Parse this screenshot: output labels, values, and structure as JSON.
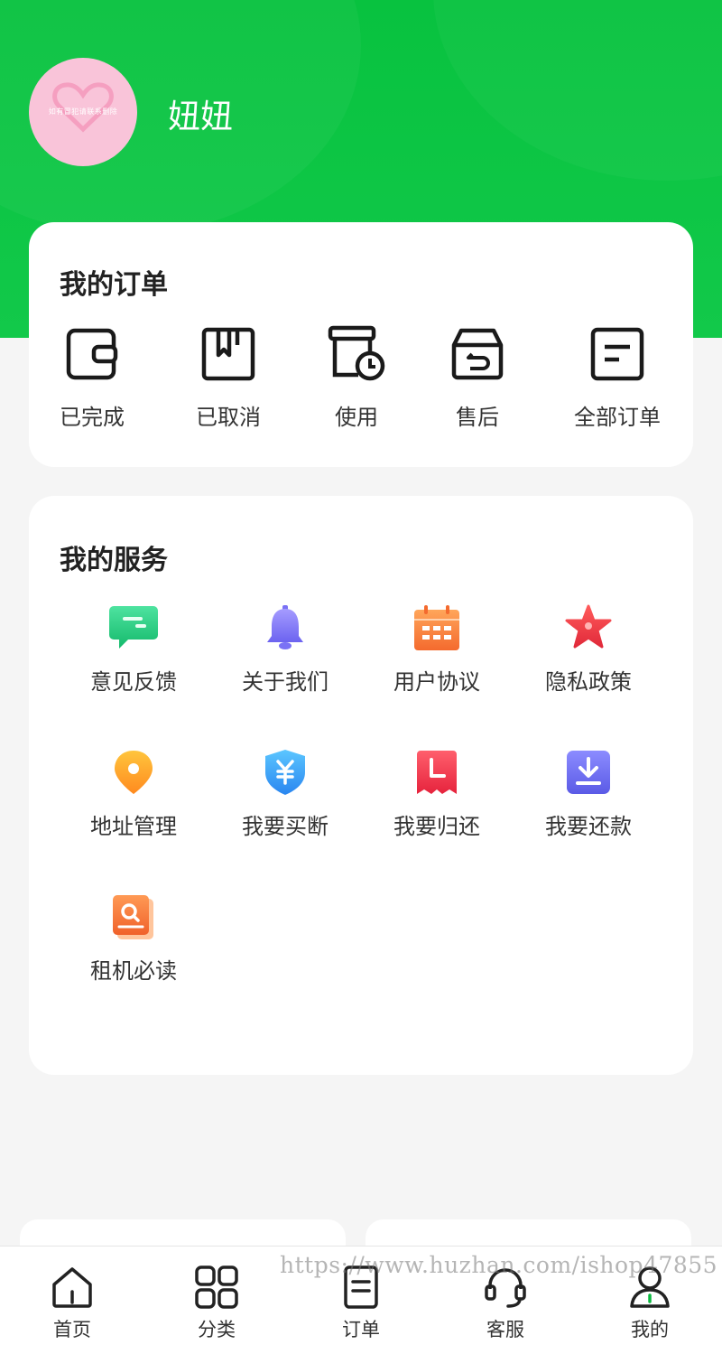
{
  "profile": {
    "username": "妞妞",
    "avatar_caption": "如有冒犯请联系删除"
  },
  "orders": {
    "title": "我的订单",
    "items": [
      {
        "label": "已完成",
        "icon": "wallet-icon"
      },
      {
        "label": "已取消",
        "icon": "box-icon"
      },
      {
        "label": "使用",
        "icon": "box-clock-icon"
      },
      {
        "label": "售后",
        "icon": "return-box-icon"
      },
      {
        "label": "全部订单",
        "icon": "list-icon"
      }
    ]
  },
  "services": {
    "title": "我的服务",
    "items": [
      {
        "label": "意见反馈",
        "icon": "feedback-icon"
      },
      {
        "label": "关于我们",
        "icon": "bell-icon"
      },
      {
        "label": "用户协议",
        "icon": "calendar-icon"
      },
      {
        "label": "隐私政策",
        "icon": "star-icon"
      },
      {
        "label": "地址管理",
        "icon": "location-pin-icon"
      },
      {
        "label": "我要买断",
        "icon": "yuan-shield-icon"
      },
      {
        "label": "我要归还",
        "icon": "return-ticket-icon"
      },
      {
        "label": "我要还款",
        "icon": "download-icon"
      },
      {
        "label": "租机必读",
        "icon": "search-book-icon"
      }
    ]
  },
  "tabbar": {
    "items": [
      {
        "label": "首页",
        "icon": "home-icon"
      },
      {
        "label": "分类",
        "icon": "grid-icon"
      },
      {
        "label": "订单",
        "icon": "document-icon"
      },
      {
        "label": "客服",
        "icon": "headset-icon"
      },
      {
        "label": "我的",
        "icon": "user-icon",
        "active": true
      }
    ]
  },
  "watermark": "https://www.huzhan.com/ishop47855",
  "colors": {
    "brand_green": "#08c23f",
    "active_green": "#09b83e"
  }
}
